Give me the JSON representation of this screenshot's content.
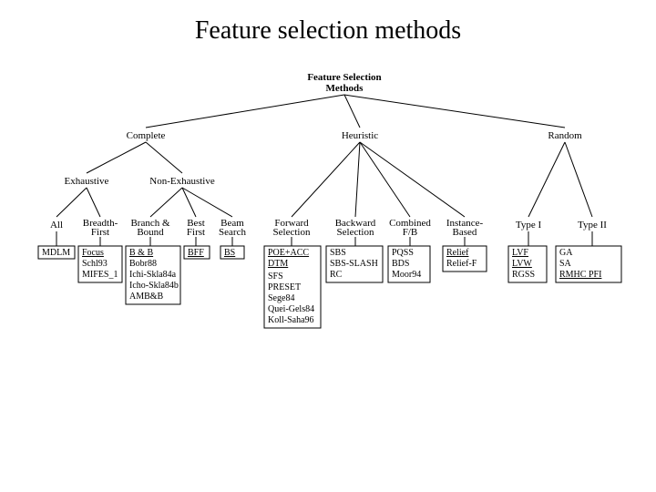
{
  "title": "Feature selection methods",
  "root": "Feature Selection\nMethods",
  "branches": {
    "complete": "Complete",
    "heuristic": "Heuristic",
    "random": "Random",
    "exhaustive": "Exhaustive",
    "nonexhaustive": "Non-Exhaustive",
    "all": "All",
    "breadth": "Breadth-\nFirst",
    "bb": "Branch &\nBound",
    "best": "Best\nFirst",
    "beam": "Beam\nSearch",
    "forward": "Forward\nSelection",
    "backward": "Backward\nSelection",
    "combined": "Combined\nF/B",
    "instance": "Instance-\nBased",
    "type1": "Type I",
    "type2": "Type II"
  },
  "leaves": {
    "all": [
      "MDLM"
    ],
    "breadth": [
      "Focus",
      "Schl93",
      "MIFES_1"
    ],
    "bb": [
      "B & B",
      "Bobr88",
      "Ichi-Skla84a",
      "Icho-Skla84b",
      "AMB&B"
    ],
    "best": [
      "BFF"
    ],
    "beam": [
      "BS"
    ],
    "forward": [
      "POE+ACC",
      "DTM",
      "SFS",
      "PRESET",
      "Sege84",
      "Quei-Gels84",
      "Koll-Saha96"
    ],
    "backward": [
      "SBS",
      "SBS-SLASH",
      "RC"
    ],
    "combined": [
      "PQSS",
      "BDS",
      "Moor94"
    ],
    "instance": [
      "Relief",
      "Relief-F"
    ],
    "type1": [
      "LVF",
      "LVW",
      "RGSS"
    ],
    "type2": [
      "GA",
      "SA",
      "RMHC PFI"
    ]
  }
}
